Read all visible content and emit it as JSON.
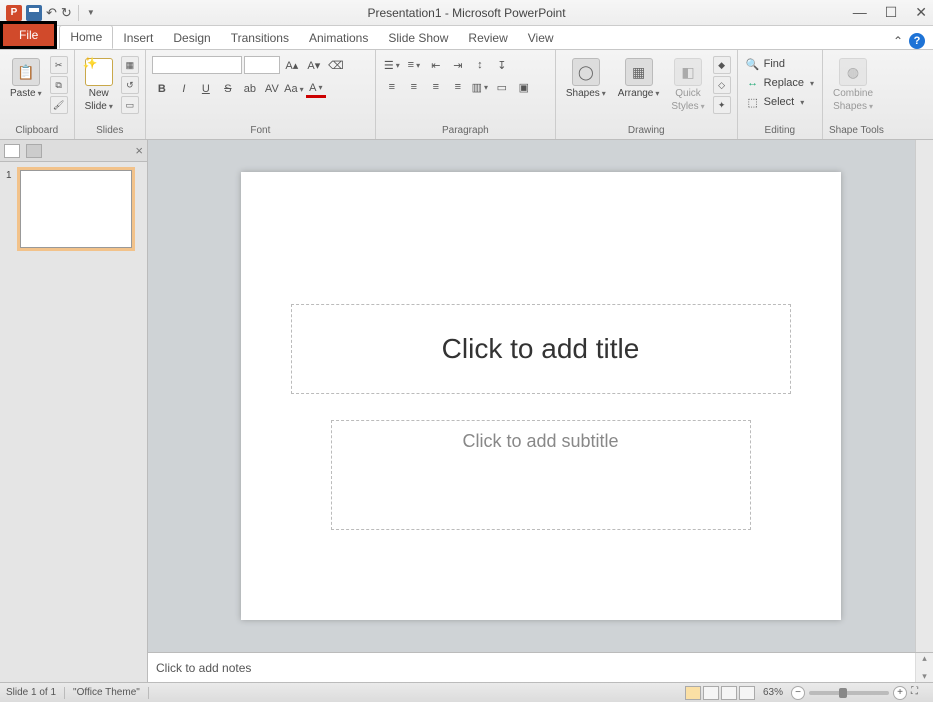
{
  "title": "Presentation1 - Microsoft PowerPoint",
  "tabs": {
    "file": "File",
    "home": "Home",
    "insert": "Insert",
    "design": "Design",
    "transitions": "Transitions",
    "animations": "Animations",
    "slideshow": "Slide Show",
    "review": "Review",
    "view": "View"
  },
  "ribbon": {
    "clipboard": {
      "paste": "Paste",
      "label": "Clipboard"
    },
    "slides": {
      "new": "New",
      "slide": "Slide",
      "label": "Slides"
    },
    "font": {
      "label": "Font"
    },
    "paragraph": {
      "label": "Paragraph"
    },
    "drawing": {
      "shapes": "Shapes",
      "arrange": "Arrange",
      "quick": "Quick",
      "styles": "Styles",
      "label": "Drawing"
    },
    "editing": {
      "find": "Find",
      "replace": "Replace",
      "select": "Select",
      "label": "Editing"
    },
    "shapetools": {
      "combine": "Combine",
      "shapes": "Shapes",
      "label": "Shape Tools"
    }
  },
  "thumb": {
    "num": "1"
  },
  "slide": {
    "title_ph": "Click to add title",
    "sub_ph": "Click to add subtitle"
  },
  "notes": {
    "placeholder": "Click to add notes"
  },
  "status": {
    "slide": "Slide 1 of 1",
    "theme": "\"Office Theme\"",
    "zoom": "63%"
  }
}
